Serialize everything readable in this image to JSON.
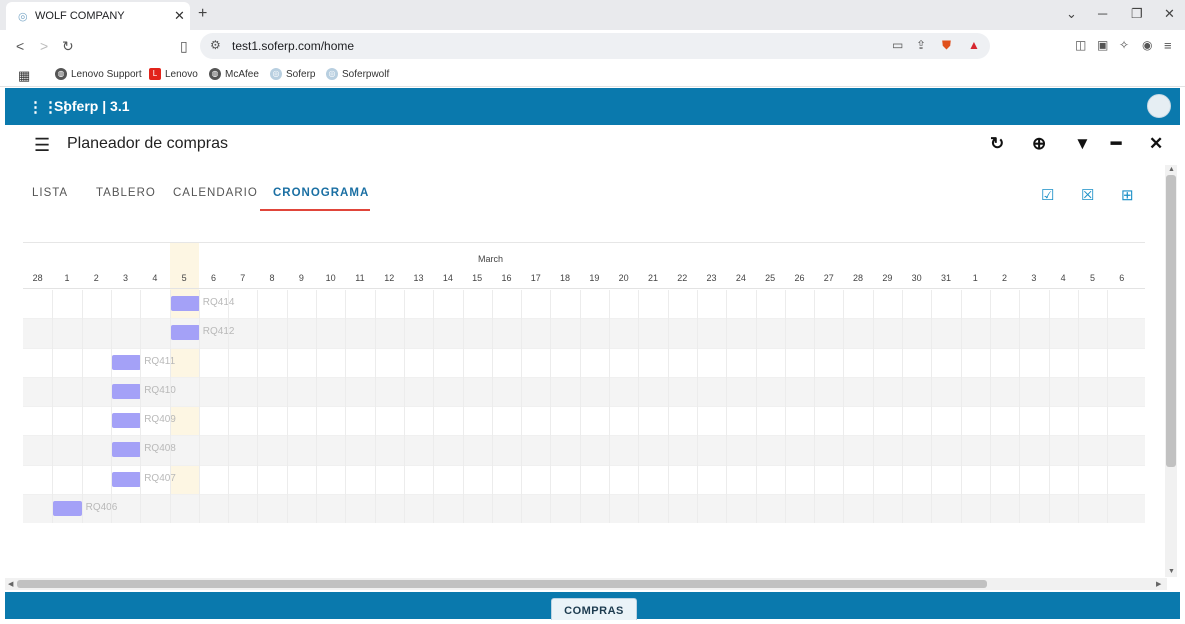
{
  "browser": {
    "tab_title": "WOLF COMPANY",
    "url": "test1.soferp.com/home",
    "bookmarks": [
      "Lenovo Support",
      "Lenovo",
      "McAfee",
      "Soferp",
      "Soferpwolf"
    ]
  },
  "app": {
    "brand": "Soferp | 3.1"
  },
  "page": {
    "title": "Planeador de compras"
  },
  "tabs": [
    {
      "label": "LISTA",
      "active": false
    },
    {
      "label": "TABLERO",
      "active": false
    },
    {
      "label": "CALENDARIO",
      "active": false
    },
    {
      "label": "CRONOGRAMA",
      "active": true
    }
  ],
  "gantt": {
    "month": "March",
    "days": [
      "28",
      "1",
      "2",
      "3",
      "4",
      "5",
      "6",
      "7",
      "8",
      "9",
      "10",
      "11",
      "12",
      "13",
      "14",
      "15",
      "16",
      "17",
      "18",
      "19",
      "20",
      "21",
      "22",
      "23",
      "24",
      "25",
      "26",
      "27",
      "28",
      "29",
      "30",
      "31",
      "1",
      "2",
      "3",
      "4",
      "5",
      "6"
    ],
    "today_index": 5,
    "tasks": [
      {
        "label": "RQ414",
        "start_index": 5
      },
      {
        "label": "RQ412",
        "start_index": 5
      },
      {
        "label": "RQ411",
        "start_index": 3
      },
      {
        "label": "RQ410",
        "start_index": 3
      },
      {
        "label": "RQ409",
        "start_index": 3
      },
      {
        "label": "RQ408",
        "start_index": 3
      },
      {
        "label": "RQ407",
        "start_index": 3
      },
      {
        "label": "RQ406",
        "start_index": 1
      }
    ],
    "bar_color": "#a4a1f7"
  },
  "footer": {
    "button_label": "COMPRAS"
  },
  "colors": {
    "header": "#0a79ad",
    "active_tab": "#1a6fa3",
    "tab_underline": "#e0453a"
  }
}
